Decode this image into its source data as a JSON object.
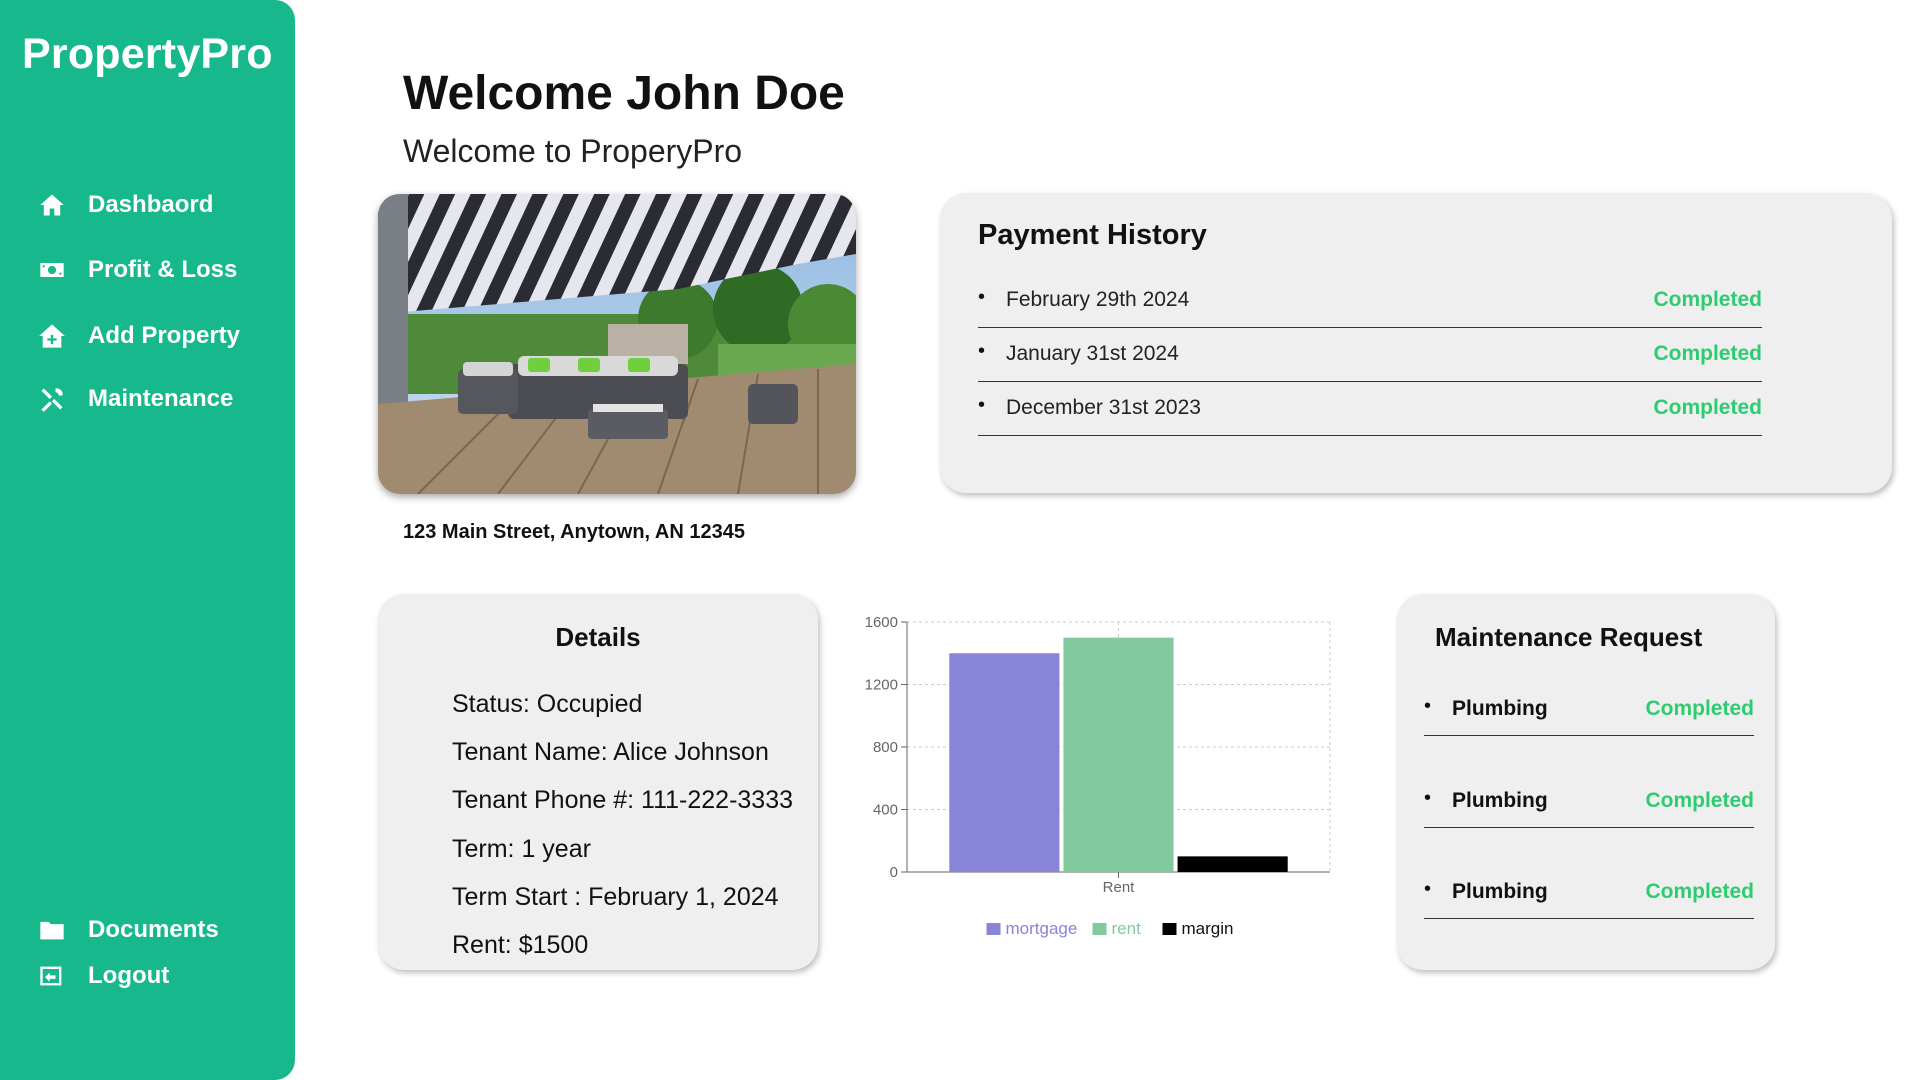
{
  "sidebar": {
    "brand": "PropertyPro",
    "nav": [
      {
        "label": "Dashbaord",
        "icon": "home-icon"
      },
      {
        "label": "Profit & Loss",
        "icon": "money-icon"
      },
      {
        "label": "Add Property",
        "icon": "add-home-icon"
      },
      {
        "label": "Maintenance",
        "icon": "tools-icon"
      }
    ],
    "bottom": [
      {
        "label": "Documents",
        "icon": "folder-icon"
      },
      {
        "label": "Logout",
        "icon": "logout-icon"
      }
    ]
  },
  "header": {
    "title": "Welcome John Doe",
    "subtitle": "Welcome to ProperyPro"
  },
  "property": {
    "address": "123 Main Street, Anytown, AN 12345"
  },
  "payment_history": {
    "title": "Payment History",
    "items": [
      {
        "date": "February 29th 2024",
        "status": "Completed"
      },
      {
        "date": "January 31st 2024",
        "status": "Completed"
      },
      {
        "date": "December 31st 2023",
        "status": "Completed"
      }
    ]
  },
  "details": {
    "title": "Details",
    "lines": [
      "Status: Occupied",
      "Tenant Name: Alice Johnson",
      "Tenant Phone #: 111-222-3333",
      "Term: 1 year",
      "Term Start : February 1, 2024",
      "Rent: $1500"
    ]
  },
  "maintenance": {
    "title": "Maintenance Request",
    "items": [
      {
        "name": "Plumbing",
        "status": "Completed"
      },
      {
        "name": "Plumbing",
        "status": "Completed"
      },
      {
        "name": "Plumbing",
        "status": "Completed"
      }
    ]
  },
  "colors": {
    "brand": "#17b88c",
    "status_completed": "#2ecc71",
    "mortgage": "#8884d8",
    "rent": "#82ca9d",
    "margin": "#000000"
  },
  "chart_data": {
    "type": "bar",
    "categories": [
      "Rent"
    ],
    "series": [
      {
        "name": "mortgage",
        "values": [
          1400
        ],
        "color": "#8884d8"
      },
      {
        "name": "rent",
        "values": [
          1500
        ],
        "color": "#82ca9d"
      },
      {
        "name": "margin",
        "values": [
          100
        ],
        "color": "#000000"
      }
    ],
    "ylim": [
      0,
      1600
    ],
    "yticks": [
      0,
      400,
      800,
      1200,
      1600
    ],
    "grid": true,
    "legend": "bottom"
  }
}
